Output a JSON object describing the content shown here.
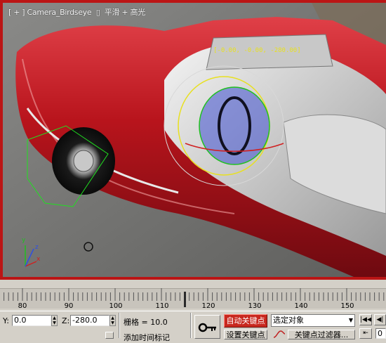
{
  "viewport": {
    "label_prefix": "[ + ] ",
    "camera_name": "Camera_Birdseye",
    "mode_marker": "▯",
    "shading_mode": "平滑 + 高光",
    "gizmo_coords": "[-0.00, -0.00, -280.00]",
    "axis_labels": {
      "x": "x",
      "y": "y",
      "z": "z"
    },
    "colors": {
      "frame": "#bb1515",
      "car_body": "#b8141c",
      "asphalt": "#6e6e6e",
      "gizmo_yellow": "#e8e020"
    }
  },
  "timeline": {
    "ticks": [
      "80",
      "90",
      "100",
      "110",
      "120",
      "130",
      "140",
      "150"
    ],
    "current_frame_marker": "▼"
  },
  "bottombar": {
    "y_label": "Y:",
    "y_value": "0.0",
    "z_label": "Z:",
    "z_value": "-280.0",
    "grid_label": "栅格 = 10.0",
    "add_time_tag": "添加时间标记",
    "auto_key_label": "自动关键点",
    "set_key_label": "设置关键点",
    "key_mode_select": "选定对象",
    "key_filters_label": "关键点过滤器...",
    "frame_field": "0"
  }
}
